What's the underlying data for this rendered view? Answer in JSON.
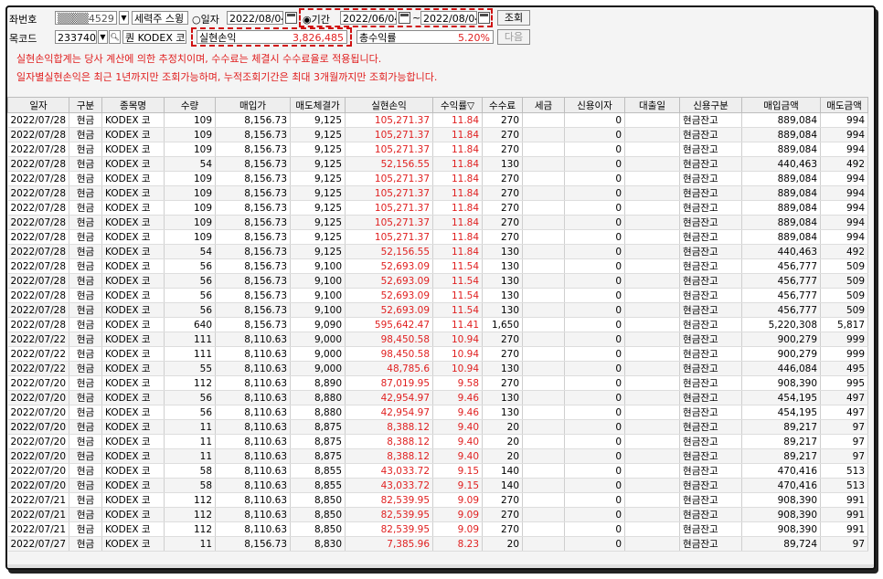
{
  "toolbar": {
    "account_label": "좌번호",
    "account_value": "▒▒▒▒4529",
    "account_name": "세력주 스윙",
    "radio_date_label": "일자",
    "date_single": "2022/08/04",
    "radio_period_label": "기간",
    "period_from": "2022/06/04",
    "period_sep": "~",
    "period_to": "2022/08/04",
    "search_button": "조회",
    "code_label": "목코드",
    "code_value": "233740",
    "stock_name": "KODEX 코",
    "stock_prefix": "퀀",
    "realized_pl_label": "실현손익",
    "realized_pl_value": "3,826,485",
    "total_return_label": "총수익률",
    "total_return_value": "5.20%",
    "next_button": "다음"
  },
  "notices": [
    "실현손익합계는 당사 계산에 의한 추정치이며, 수수료는 체결시 수수료율로 적용됩니다.",
    "일자별실현손익은 최근 1년까지만 조회가능하며, 누적조회기간은 최대 3개월까지만 조회가능합니다."
  ],
  "table": {
    "headers": [
      "일자",
      "구분",
      "종목명",
      "수량",
      "매입가",
      "매도체결가",
      "실현손익",
      "수익률▽",
      "수수료",
      "세금",
      "신용이자",
      "대출일",
      "신용구분",
      "매입금액",
      "매도금액"
    ],
    "rows": [
      [
        "2022/07/28",
        "현금",
        "KODEX 코",
        "109",
        "8,156.73",
        "9,125",
        "105,271.37",
        "11.84",
        "270",
        "",
        "0",
        "",
        "현금잔고",
        "889,084",
        "994"
      ],
      [
        "2022/07/28",
        "현금",
        "KODEX 코",
        "109",
        "8,156.73",
        "9,125",
        "105,271.37",
        "11.84",
        "270",
        "",
        "0",
        "",
        "현금잔고",
        "889,084",
        "994"
      ],
      [
        "2022/07/28",
        "현금",
        "KODEX 코",
        "109",
        "8,156.73",
        "9,125",
        "105,271.37",
        "11.84",
        "270",
        "",
        "0",
        "",
        "현금잔고",
        "889,084",
        "994"
      ],
      [
        "2022/07/28",
        "현금",
        "KODEX 코",
        "54",
        "8,156.73",
        "9,125",
        "52,156.55",
        "11.84",
        "130",
        "",
        "0",
        "",
        "현금잔고",
        "440,463",
        "492"
      ],
      [
        "2022/07/28",
        "현금",
        "KODEX 코",
        "109",
        "8,156.73",
        "9,125",
        "105,271.37",
        "11.84",
        "270",
        "",
        "0",
        "",
        "현금잔고",
        "889,084",
        "994"
      ],
      [
        "2022/07/28",
        "현금",
        "KODEX 코",
        "109",
        "8,156.73",
        "9,125",
        "105,271.37",
        "11.84",
        "270",
        "",
        "0",
        "",
        "현금잔고",
        "889,084",
        "994"
      ],
      [
        "2022/07/28",
        "현금",
        "KODEX 코",
        "109",
        "8,156.73",
        "9,125",
        "105,271.37",
        "11.84",
        "270",
        "",
        "0",
        "",
        "현금잔고",
        "889,084",
        "994"
      ],
      [
        "2022/07/28",
        "현금",
        "KODEX 코",
        "109",
        "8,156.73",
        "9,125",
        "105,271.37",
        "11.84",
        "270",
        "",
        "0",
        "",
        "현금잔고",
        "889,084",
        "994"
      ],
      [
        "2022/07/28",
        "현금",
        "KODEX 코",
        "109",
        "8,156.73",
        "9,125",
        "105,271.37",
        "11.84",
        "270",
        "",
        "0",
        "",
        "현금잔고",
        "889,084",
        "994"
      ],
      [
        "2022/07/28",
        "현금",
        "KODEX 코",
        "54",
        "8,156.73",
        "9,125",
        "52,156.55",
        "11.84",
        "130",
        "",
        "0",
        "",
        "현금잔고",
        "440,463",
        "492"
      ],
      [
        "2022/07/28",
        "현금",
        "KODEX 코",
        "56",
        "8,156.73",
        "9,100",
        "52,693.09",
        "11.54",
        "130",
        "",
        "0",
        "",
        "현금잔고",
        "456,777",
        "509"
      ],
      [
        "2022/07/28",
        "현금",
        "KODEX 코",
        "56",
        "8,156.73",
        "9,100",
        "52,693.09",
        "11.54",
        "130",
        "",
        "0",
        "",
        "현금잔고",
        "456,777",
        "509"
      ],
      [
        "2022/07/28",
        "현금",
        "KODEX 코",
        "56",
        "8,156.73",
        "9,100",
        "52,693.09",
        "11.54",
        "130",
        "",
        "0",
        "",
        "현금잔고",
        "456,777",
        "509"
      ],
      [
        "2022/07/28",
        "현금",
        "KODEX 코",
        "56",
        "8,156.73",
        "9,100",
        "52,693.09",
        "11.54",
        "130",
        "",
        "0",
        "",
        "현금잔고",
        "456,777",
        "509"
      ],
      [
        "2022/07/28",
        "현금",
        "KODEX 코",
        "640",
        "8,156.73",
        "9,090",
        "595,642.47",
        "11.41",
        "1,650",
        "",
        "0",
        "",
        "현금잔고",
        "5,220,308",
        "5,817"
      ],
      [
        "2022/07/22",
        "현금",
        "KODEX 코",
        "111",
        "8,110.63",
        "9,000",
        "98,450.58",
        "10.94",
        "270",
        "",
        "0",
        "",
        "현금잔고",
        "900,279",
        "999"
      ],
      [
        "2022/07/22",
        "현금",
        "KODEX 코",
        "111",
        "8,110.63",
        "9,000",
        "98,450.58",
        "10.94",
        "270",
        "",
        "0",
        "",
        "현금잔고",
        "900,279",
        "999"
      ],
      [
        "2022/07/22",
        "현금",
        "KODEX 코",
        "55",
        "8,110.63",
        "9,000",
        "48,785.6",
        "10.94",
        "130",
        "",
        "0",
        "",
        "현금잔고",
        "446,084",
        "495"
      ],
      [
        "2022/07/20",
        "현금",
        "KODEX 코",
        "112",
        "8,110.63",
        "8,890",
        "87,019.95",
        "9.58",
        "270",
        "",
        "0",
        "",
        "현금잔고",
        "908,390",
        "995"
      ],
      [
        "2022/07/20",
        "현금",
        "KODEX 코",
        "56",
        "8,110.63",
        "8,880",
        "42,954.97",
        "9.46",
        "130",
        "",
        "0",
        "",
        "현금잔고",
        "454,195",
        "497"
      ],
      [
        "2022/07/20",
        "현금",
        "KODEX 코",
        "56",
        "8,110.63",
        "8,880",
        "42,954.97",
        "9.46",
        "130",
        "",
        "0",
        "",
        "현금잔고",
        "454,195",
        "497"
      ],
      [
        "2022/07/20",
        "현금",
        "KODEX 코",
        "11",
        "8,110.63",
        "8,875",
        "8,388.12",
        "9.40",
        "20",
        "",
        "0",
        "",
        "현금잔고",
        "89,217",
        "97"
      ],
      [
        "2022/07/20",
        "현금",
        "KODEX 코",
        "11",
        "8,110.63",
        "8,875",
        "8,388.12",
        "9.40",
        "20",
        "",
        "0",
        "",
        "현금잔고",
        "89,217",
        "97"
      ],
      [
        "2022/07/20",
        "현금",
        "KODEX 코",
        "11",
        "8,110.63",
        "8,875",
        "8,388.12",
        "9.40",
        "20",
        "",
        "0",
        "",
        "현금잔고",
        "89,217",
        "97"
      ],
      [
        "2022/07/20",
        "현금",
        "KODEX 코",
        "58",
        "8,110.63",
        "8,855",
        "43,033.72",
        "9.15",
        "140",
        "",
        "0",
        "",
        "현금잔고",
        "470,416",
        "513"
      ],
      [
        "2022/07/20",
        "현금",
        "KODEX 코",
        "58",
        "8,110.63",
        "8,855",
        "43,033.72",
        "9.15",
        "140",
        "",
        "0",
        "",
        "현금잔고",
        "470,416",
        "513"
      ],
      [
        "2022/07/21",
        "현금",
        "KODEX 코",
        "112",
        "8,110.63",
        "8,850",
        "82,539.95",
        "9.09",
        "270",
        "",
        "0",
        "",
        "현금잔고",
        "908,390",
        "991"
      ],
      [
        "2022/07/21",
        "현금",
        "KODEX 코",
        "112",
        "8,110.63",
        "8,850",
        "82,539.95",
        "9.09",
        "270",
        "",
        "0",
        "",
        "현금잔고",
        "908,390",
        "991"
      ],
      [
        "2022/07/21",
        "현금",
        "KODEX 코",
        "112",
        "8,110.63",
        "8,850",
        "82,539.95",
        "9.09",
        "270",
        "",
        "0",
        "",
        "현금잔고",
        "908,390",
        "991"
      ],
      [
        "2022/07/27",
        "현금",
        "KODEX 코",
        "11",
        "8,156.73",
        "8,830",
        "7,385.96",
        "8.23",
        "20",
        "",
        "0",
        "",
        "현금잔고",
        "89,724",
        "97"
      ]
    ]
  },
  "colors": {
    "profit_red": "#e01f1f",
    "highlight_dashed": "#d01010"
  }
}
